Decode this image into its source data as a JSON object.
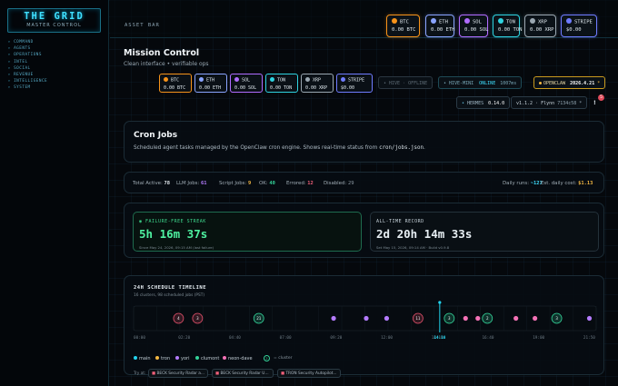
{
  "sidebar": {
    "logo_title": "THE GRID",
    "logo_subtitle": "MASTER CONTROL",
    "nav": [
      "COMMAND",
      "AGENTS",
      "OPERATIONS",
      "INTEL",
      "SOCIAL",
      "REVENUE",
      "INTELLIGENCE",
      "SYSTEM"
    ]
  },
  "topbar": {
    "asset_label": "ASSET BAR",
    "tickers": [
      {
        "sym": "BTC",
        "val": "0.00 BTC",
        "icon": "bitcoin-icon",
        "color": "#f7931a"
      },
      {
        "sym": "ETH",
        "val": "0.00 ETH",
        "icon": "ethereum-icon",
        "color": "#8aa4ff"
      },
      {
        "sym": "SOL",
        "val": "0.00 SOL",
        "icon": "solana-icon",
        "color": "#b06cff"
      },
      {
        "sym": "TON",
        "val": "0.00 TON",
        "icon": "ton-icon",
        "color": "#2fd3e0"
      },
      {
        "sym": "XRP",
        "val": "0.00 XRP",
        "icon": "xrp-icon",
        "color": "#9aa7b1"
      },
      {
        "sym": "STRIPE",
        "val": "$0.00",
        "icon": "stripe-icon",
        "color": "#6f7cff"
      }
    ]
  },
  "mission": {
    "title": "Mission Control",
    "subtitle": "Clean interface • verifiable ops",
    "tickers": [
      {
        "sym": "BTC",
        "val": "0.00 BTC",
        "color": "#f7931a"
      },
      {
        "sym": "ETH",
        "val": "0.00 ETH",
        "color": "#8aa4ff"
      },
      {
        "sym": "SOL",
        "val": "0.00 SOL",
        "color": "#b06cff"
      },
      {
        "sym": "TON",
        "val": "0.00 TON",
        "color": "#2fd3e0"
      },
      {
        "sym": "XRP",
        "val": "0.00 XRP",
        "color": "#9aa7b1"
      },
      {
        "sym": "STRIPE",
        "val": "$0.00",
        "color": "#6f7cff"
      }
    ],
    "hive_offline": "• HIVE · OFFLINE",
    "hive_mini_label": "• HIVE-MINI",
    "hive_mini_status": "ONLINE",
    "hive_mini_ping": "1007ms",
    "openclaw_label": "OPENCLAW",
    "openclaw_version": "2026.4.21",
    "openclaw_mark": "*",
    "hermes_label": "HERMES",
    "hermes_version": "0.14.0",
    "flynn_version": "v1.1.2",
    "flynn_sep": "·",
    "flynn_label": "Flynn",
    "flynn_hash": "7134c58",
    "flynn_mark": "*",
    "notif_count": "5",
    "notif_bang": "!"
  },
  "cron": {
    "title": "Cron Jobs",
    "desc_prefix": "Scheduled agent tasks managed by the OpenClaw cron engine. Shows real-time status from ",
    "desc_code": "cron/jobs.json",
    "desc_suffix": "."
  },
  "stats": {
    "total_label": "Total Active:",
    "total": "78",
    "llm_label": "LLM Jobs:",
    "llm": "61",
    "script_label": "Script Jobs:",
    "script": "9",
    "ok_label": "OK:",
    "ok": "40",
    "errored_label": "Errored:",
    "errored": "12",
    "disabled_label": "Disabled:",
    "disabled": "29",
    "daily_runs_label": "Daily runs:",
    "daily_runs": "~127",
    "daily_cost_label": "Est. daily cost:",
    "daily_cost": "$1.13"
  },
  "streak": {
    "label": "FAILURE-FREE STREAK",
    "value": "5h 16m 37s",
    "since": "Since May 24, 2026, 09:15 AM (last failure)",
    "record_label": "ALL-TIME RECORD",
    "record_value": "2d 20h 14m 33s",
    "record_sub": "Set May 15, 2026, 09:14 AM · Build v0.9.8"
  },
  "timeline": {
    "title": "24H SCHEDULE TIMELINE",
    "subtitle": "16 clusters, 98 scheduled jobs (PST)",
    "ticks": [
      "00:00",
      "02:20",
      "04:40",
      "07:00",
      "09:20",
      "12:00",
      "14:10",
      "16:40",
      "19:00",
      "21:50"
    ],
    "now_label": "14:10",
    "legend": [
      {
        "name": "main",
        "color": "#22d3ee"
      },
      {
        "name": "tron",
        "color": "#f5b942"
      },
      {
        "name": "yori",
        "color": "#b47cff"
      },
      {
        "name": "clumont",
        "color": "#34d399"
      },
      {
        "name": "neon-dave",
        "color": "#f472b6"
      }
    ],
    "cluster_hint": "= cluster",
    "cluster_num": "2",
    "try_label": "Try at:",
    "jobs": [
      "BECK Security Radar a...",
      "BECK Security Radar U...",
      "TRON Security Autopilot..."
    ],
    "points": [
      {
        "h": 3.3,
        "kind": "cluster",
        "n": "4",
        "color": "#e0506a"
      },
      {
        "h": 4.7,
        "kind": "cluster",
        "n": "3",
        "color": "#e0506a"
      },
      {
        "h": 9.2,
        "kind": "cluster",
        "n": "21",
        "color": "#34d399"
      },
      {
        "h": 14.7,
        "kind": "dot",
        "color": "#b47cff"
      },
      {
        "h": 17.1,
        "kind": "dot",
        "color": "#b47cff"
      },
      {
        "h": 18.6,
        "kind": "dot",
        "color": "#b47cff"
      },
      {
        "h": 20.9,
        "kind": "cluster",
        "n": "11",
        "color": "#e0506a"
      },
      {
        "h": 23.2,
        "kind": "cluster",
        "n": "3",
        "color": "#34d399"
      },
      {
        "h": 24.4,
        "kind": "dot",
        "color": "#f472b6"
      },
      {
        "h": 25.3,
        "kind": "dot",
        "color": "#f472b6"
      },
      {
        "h": 26.0,
        "kind": "cluster",
        "n": "2",
        "color": "#34d399"
      },
      {
        "h": 28.1,
        "kind": "dot",
        "color": "#f472b6"
      },
      {
        "h": 29.5,
        "kind": "dot",
        "color": "#f472b6"
      },
      {
        "h": 31.1,
        "kind": "cluster",
        "n": "3",
        "color": "#34d399"
      },
      {
        "h": 33.5,
        "kind": "dot",
        "color": "#b47cff"
      }
    ]
  }
}
